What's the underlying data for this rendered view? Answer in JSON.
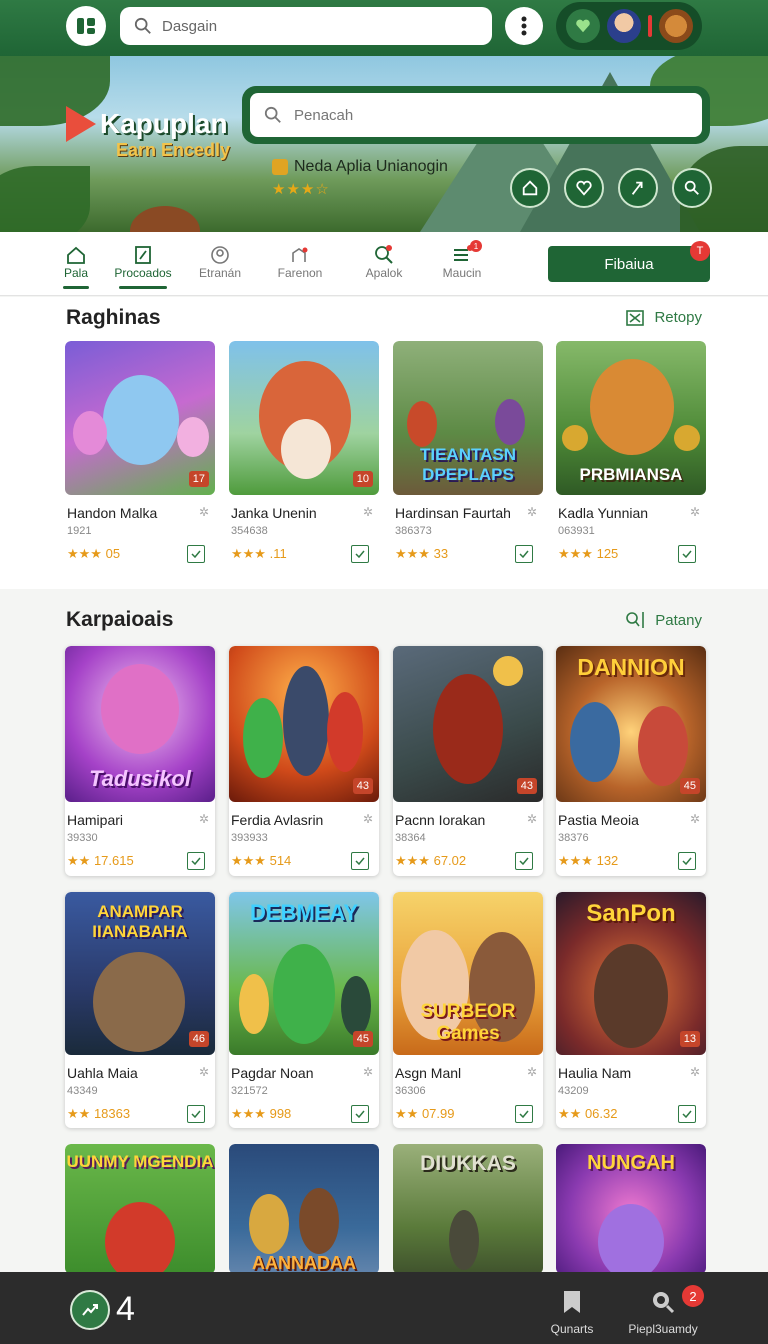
{
  "topbar": {
    "search_placeholder": "Dasgain"
  },
  "hero": {
    "brand": "Kapuplan",
    "brand_sub": "Earn Encedly",
    "search_placeholder": "Penacah",
    "featured_app": "Neda Aplia Unianogin",
    "stars": "★★★☆"
  },
  "nav": {
    "items": [
      {
        "label": "Pala",
        "icon": "home-icon"
      },
      {
        "label": "Procoados",
        "icon": "edit-icon"
      },
      {
        "label": "Etranán",
        "icon": "user-icon"
      },
      {
        "label": "Farenon",
        "icon": "chart-icon"
      },
      {
        "label": "Apalok",
        "icon": "search-icon"
      },
      {
        "label": "Maucin",
        "icon": "list-icon"
      }
    ],
    "filter_label": "Fibaiua",
    "filter_badge": "T",
    "maucin_badge": "1"
  },
  "sections": [
    {
      "title": "Raghinas",
      "link": "Retopy",
      "cards": [
        {
          "name": "Handon Malka",
          "sub": "1921",
          "stars": "★★★",
          "rating": "05",
          "tag": "17"
        },
        {
          "name": "Janka Unenin",
          "sub": "354638",
          "stars": "★★★",
          "rating": ".11",
          "tag": "10"
        },
        {
          "name": "Hardinsan Faurtah",
          "sub": "386373",
          "stars": "★★★",
          "rating": "33",
          "thumb_title": "TIEANTASN DPEPLAPS"
        },
        {
          "name": "Kadla Yunnian",
          "sub": "063931",
          "stars": "★★★",
          "rating": "125",
          "thumb_title": "PRBMIANSA"
        }
      ]
    },
    {
      "title": "Karpaioais",
      "link": "Patany",
      "cards": [
        {
          "name": "Hamipari",
          "sub": "39330",
          "stars": "★★",
          "rating": "17.615",
          "thumb_title": "Tadusikol"
        },
        {
          "name": "Ferdia Avlasrin",
          "sub": "393933",
          "stars": "★★★",
          "rating": "514",
          "tag": "43"
        },
        {
          "name": "Pacnn Iorakan",
          "sub": "38364",
          "stars": "★★★",
          "rating": "67.02",
          "tag": "43"
        },
        {
          "name": "Pastia Meoia",
          "sub": "38376",
          "stars": "★★★",
          "rating": "132",
          "thumb_title": "DANNION",
          "tag": "45"
        },
        {
          "name": "Uahla Maia",
          "sub": "43349",
          "stars": "★★",
          "rating": "18363",
          "thumb_title": "ANAMPAR IIANABAHA",
          "tag": "46"
        },
        {
          "name": "Pagdar Noan",
          "sub": "321572",
          "stars": "★★★",
          "rating": "998",
          "thumb_title": "DEBMEAY",
          "tag": "45"
        },
        {
          "name": "Asgn Manl",
          "sub": "36306",
          "stars": "★★",
          "rating": "07.99",
          "thumb_title": "SURBEOR Games"
        },
        {
          "name": "Haulia Nam",
          "sub": "43209",
          "stars": "★★",
          "rating": "06.32",
          "thumb_title": "SanPon",
          "tag": "13"
        },
        {
          "thumb_title": "UUNMY MGENDIA"
        },
        {
          "thumb_title": "AANNADAA"
        },
        {
          "thumb_title": "DIUKKAS"
        },
        {
          "thumb_title": "NUNGAH"
        }
      ]
    }
  ],
  "bottombar": {
    "count": "4",
    "items": [
      {
        "label": "Qunarts",
        "icon": "bookmark-icon"
      },
      {
        "label": "Piepl3uamdy",
        "icon": "search-icon",
        "badge": "2"
      }
    ]
  },
  "colors": {
    "brand": "#1f6535",
    "accent": "#e69a1a",
    "badge": "#e53935"
  }
}
